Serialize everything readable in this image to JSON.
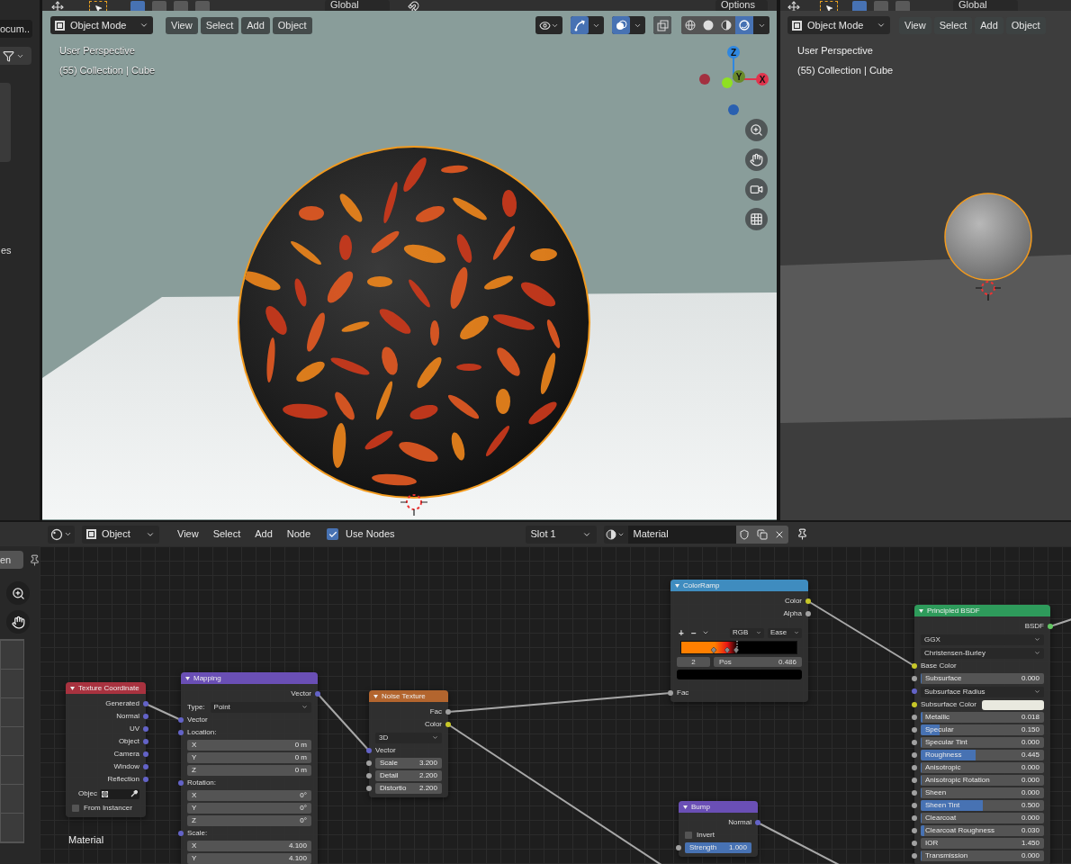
{
  "top_strip": {
    "main_orientation": "Global",
    "options": "Options",
    "right_orientation": "Global"
  },
  "left_panel": {
    "field": "ocum..",
    "label": "es"
  },
  "viewport": {
    "mode": "Object Mode",
    "menus": [
      "View",
      "Select",
      "Add",
      "Object"
    ],
    "overlay_lines": [
      "User Perspective",
      "(55) Collection | Cube"
    ],
    "toggles": [
      {
        "kind": "gizmo",
        "on": true
      },
      {
        "kind": "overlay",
        "on": true
      },
      {
        "kind": "xray",
        "on": false
      }
    ],
    "shading": [
      {
        "kind": "wireframe",
        "selected": false
      },
      {
        "kind": "solid",
        "selected": false
      },
      {
        "kind": "material",
        "selected": false
      },
      {
        "kind": "rendered",
        "selected": true
      }
    ],
    "axes": [
      "Z",
      "Y",
      "X"
    ]
  },
  "viewport_right": {
    "mode": "Object Mode",
    "menus": [
      "View",
      "Select",
      "Add",
      "Object"
    ],
    "overlay_lines": [
      "User Perspective",
      "(55) Collection | Cube"
    ]
  },
  "node_editor": {
    "mode": "Object",
    "menus": [
      "View",
      "Select",
      "Add",
      "Node"
    ],
    "use_nodes": {
      "label": "Use Nodes",
      "checked": true
    },
    "slot": "Slot 1",
    "material": "Material",
    "side_tab": "en",
    "frame_label": "Material",
    "nodes": [
      {
        "title": "Texture Coordinate",
        "color": "#a8323f",
        "rows": [
          {
            "kind": "output",
            "label": "Generated",
            "socket": {
              "color": "#6363c7"
            }
          },
          {
            "kind": "output",
            "label": "Normal",
            "socket": {
              "color": "#6363c7"
            }
          },
          {
            "kind": "output",
            "label": "UV",
            "socket": {
              "color": "#6363c7"
            }
          },
          {
            "kind": "output",
            "label": "Object",
            "socket": {
              "color": "#6363c7"
            }
          },
          {
            "kind": "output",
            "label": "Camera",
            "socket": {
              "color": "#6363c7"
            }
          },
          {
            "kind": "output",
            "label": "Window",
            "socket": {
              "color": "#6363c7"
            }
          },
          {
            "kind": "output",
            "label": "Reflection",
            "socket": {
              "color": "#6363c7"
            }
          },
          {
            "kind": "object",
            "label": "Objec"
          },
          {
            "kind": "checkbox",
            "label": "From Instancer",
            "checked": false
          }
        ]
      },
      {
        "title": "Mapping",
        "color": "#6a4fb5",
        "rows": [
          {
            "kind": "output",
            "label": "Vector",
            "socket": {
              "color": "#6363c7"
            }
          },
          {
            "kind": "select",
            "label": "Type:",
            "value": "Point"
          },
          {
            "kind": "input",
            "label": "Vector",
            "socket": {
              "color": "#6363c7"
            }
          },
          {
            "kind": "heading",
            "label": "Location:",
            "socket": {
              "color": "#6363c7"
            }
          },
          {
            "kind": "value",
            "label": "X",
            "value": "0 m"
          },
          {
            "kind": "value",
            "label": "Y",
            "value": "0 m"
          },
          {
            "kind": "value",
            "label": "Z",
            "value": "0 m"
          },
          {
            "kind": "heading",
            "label": "Rotation:",
            "socket": {
              "color": "#6363c7"
            }
          },
          {
            "kind": "value",
            "label": "X",
            "value": "0°"
          },
          {
            "kind": "value",
            "label": "Y",
            "value": "0°"
          },
          {
            "kind": "value",
            "label": "Z",
            "value": "0°"
          },
          {
            "kind": "heading",
            "label": "Scale:",
            "socket": {
              "color": "#6363c7"
            }
          },
          {
            "kind": "value",
            "label": "X",
            "value": "4.100"
          },
          {
            "kind": "value",
            "label": "Y",
            "value": "4.100"
          }
        ]
      },
      {
        "title": "Noise Texture",
        "color": "#b3652e",
        "rows": [
          {
            "kind": "output",
            "label": "Fac",
            "socket": {
              "color": "#a1a1a1"
            }
          },
          {
            "kind": "output",
            "label": "Color",
            "socket": {
              "color": "#c7c729"
            }
          },
          {
            "kind": "select",
            "value": "3D"
          },
          {
            "kind": "input",
            "label": "Vector",
            "socket": {
              "color": "#6363c7"
            }
          },
          {
            "kind": "value",
            "label": "Scale",
            "value": "3.200",
            "socket": {
              "color": "#a1a1a1"
            }
          },
          {
            "kind": "value",
            "label": "Detail",
            "value": "2.200",
            "socket": {
              "color": "#a1a1a1"
            }
          },
          {
            "kind": "value",
            "label": "Distortio",
            "value": "2.200",
            "socket": {
              "color": "#a1a1a1"
            }
          }
        ]
      },
      {
        "title": "ColorRamp",
        "color": "#3f8cbf",
        "rows": [
          {
            "kind": "output",
            "label": "Color",
            "socket": {
              "color": "#c7c729"
            }
          },
          {
            "kind": "output",
            "label": "Alpha",
            "socket": {
              "color": "#a1a1a1"
            }
          },
          {
            "kind": "ramp",
            "tools": [
              "+",
              "−"
            ],
            "color_mode": "RGB",
            "interpolation": "Ease",
            "index": "2",
            "pos_label": "Pos",
            "pos_value": "0.486"
          },
          {
            "kind": "input",
            "label": "Fac",
            "socket": {
              "color": "#a1a1a1"
            }
          }
        ]
      },
      {
        "title": "Bump",
        "color": "#6a4fb5",
        "rows": [
          {
            "kind": "output",
            "label": "Normal",
            "socket": {
              "color": "#6363c7"
            }
          },
          {
            "kind": "checkbox",
            "label": "Invert",
            "checked": false
          },
          {
            "kind": "value",
            "label": "Strength",
            "value": "1.000",
            "socket": {
              "color": "#a1a1a1"
            },
            "level": 1
          }
        ]
      },
      {
        "title": "Principled BSDF",
        "color": "#2e9b5b",
        "rows": [
          {
            "kind": "output",
            "label": "BSDF",
            "socket": {
              "color": "#63c763"
            }
          },
          {
            "kind": "select",
            "value": "GGX"
          },
          {
            "kind": "select",
            "value": "Christensen-Burley"
          },
          {
            "kind": "input",
            "label": "Base Color",
            "socket": {
              "color": "#c7c729"
            }
          },
          {
            "kind": "value",
            "label": "Subsurface",
            "value": "0.000",
            "socket": {
              "color": "#a1a1a1"
            },
            "level": 0
          },
          {
            "kind": "select",
            "value": "Subsurface Radius",
            "socket": {
              "color": "#6363c7"
            }
          },
          {
            "kind": "swatch",
            "label": "Subsurface Color",
            "socket": {
              "color": "#c7c729"
            }
          },
          {
            "kind": "value",
            "label": "Metallic",
            "value": "0.018",
            "socket": {
              "color": "#a1a1a1"
            },
            "level": 0.018
          },
          {
            "kind": "value",
            "label": "Specular",
            "value": "0.150",
            "socket": {
              "color": "#a1a1a1"
            },
            "level": 0.15
          },
          {
            "kind": "value",
            "label": "Specular Tint",
            "value": "0.000",
            "socket": {
              "color": "#a1a1a1"
            },
            "level": 0
          },
          {
            "kind": "value",
            "label": "Roughness",
            "value": "0.445",
            "socket": {
              "color": "#a1a1a1"
            },
            "level": 0.445
          },
          {
            "kind": "value",
            "label": "Anisotropic",
            "value": "0.000",
            "socket": {
              "color": "#a1a1a1"
            },
            "level": 0
          },
          {
            "kind": "value",
            "label": "Anisotropic Rotation",
            "value": "0.000",
            "socket": {
              "color": "#a1a1a1"
            },
            "level": 0
          },
          {
            "kind": "value",
            "label": "Sheen",
            "value": "0.000",
            "socket": {
              "color": "#a1a1a1"
            },
            "level": 0
          },
          {
            "kind": "value",
            "label": "Sheen Tint",
            "value": "0.500",
            "socket": {
              "color": "#a1a1a1"
            },
            "level": 0.5
          },
          {
            "kind": "value",
            "label": "Clearcoat",
            "value": "0.000",
            "socket": {
              "color": "#a1a1a1"
            },
            "level": 0
          },
          {
            "kind": "value",
            "label": "Clearcoat Roughness",
            "value": "0.030",
            "socket": {
              "color": "#a1a1a1"
            },
            "level": 0.03
          },
          {
            "kind": "value",
            "label": "IOR",
            "value": "1.450",
            "socket": {
              "color": "#a1a1a1"
            }
          },
          {
            "kind": "value",
            "label": "Transmission",
            "value": "0.000",
            "socket": {
              "color": "#a1a1a1"
            },
            "level": 0
          }
        ]
      }
    ]
  }
}
